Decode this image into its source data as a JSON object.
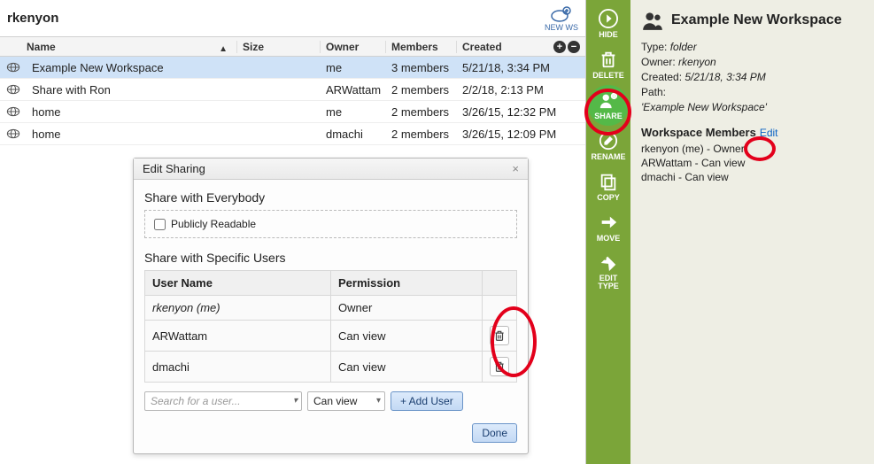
{
  "header": {
    "title": "rkenyon",
    "new_ws_label": "NEW WS"
  },
  "columns": {
    "name": "Name",
    "size": "Size",
    "owner": "Owner",
    "members": "Members",
    "created": "Created"
  },
  "rows": [
    {
      "name": "Example New Workspace",
      "size": "",
      "owner": "me",
      "members": "3 members",
      "created": "5/21/18, 3:34 PM",
      "selected": true
    },
    {
      "name": "Share with Ron",
      "size": "",
      "owner": "ARWattam",
      "members": "2 members",
      "created": "2/2/18, 2:13 PM",
      "selected": false
    },
    {
      "name": "home",
      "size": "",
      "owner": "me",
      "members": "2 members",
      "created": "3/26/15, 12:32 PM",
      "selected": false
    },
    {
      "name": "home",
      "size": "",
      "owner": "dmachi",
      "members": "2 members",
      "created": "3/26/15, 12:09 PM",
      "selected": false
    }
  ],
  "dialog": {
    "title": "Edit Sharing",
    "share_all_title": "Share with Everybody",
    "public_label": "Publicly Readable",
    "share_specific_title": "Share with Specific Users",
    "col_user": "User Name",
    "col_perm": "Permission",
    "users": [
      {
        "name": "rkenyon (me)",
        "perm": "Owner",
        "me": true,
        "removable": false
      },
      {
        "name": "ARWattam",
        "perm": "Can view",
        "me": false,
        "removable": true
      },
      {
        "name": "dmachi",
        "perm": "Can view",
        "me": false,
        "removable": true
      }
    ],
    "search_placeholder": "Search for a user...",
    "default_perm": "Can view",
    "add_user_label": "+ Add User",
    "done_label": "Done"
  },
  "strip": {
    "hide": "HIDE",
    "delete": "DELETE",
    "share": "SHARE",
    "rename": "RENAME",
    "copy": "COPY",
    "move": "MOVE",
    "edit_type": "EDIT TYPE"
  },
  "details": {
    "title": "Example New Workspace",
    "type_label": "Type:",
    "type_value": "folder",
    "owner_label": "Owner:",
    "owner_value": "rkenyon",
    "created_label": "Created:",
    "created_value": "5/21/18, 3:34 PM",
    "path_label": "Path:",
    "path_value": "'Example New Workspace'",
    "members_head": "Workspace Members",
    "edit_link": "Edit",
    "members": [
      "rkenyon (me) - Owner",
      "ARWattam - Can view",
      "dmachi - Can view"
    ]
  }
}
